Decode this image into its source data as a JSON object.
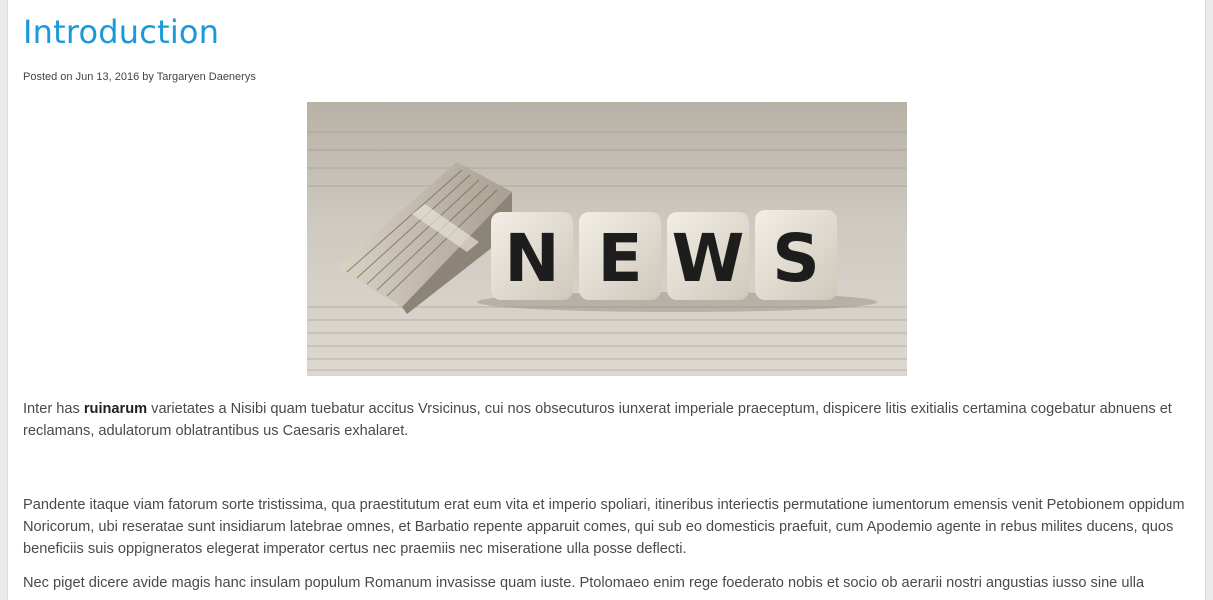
{
  "post": {
    "title": "Introduction",
    "meta": {
      "prefix": "Posted on",
      "date": "Jun 13, 2016",
      "by": "by",
      "author": "Targaryen Daenerys"
    },
    "image": {
      "dice_letters": [
        "N",
        "E",
        "W",
        "S"
      ]
    },
    "paragraphs": {
      "p1_before": "Inter has ",
      "p1_bold": "ruinarum",
      "p1_after": " varietates a Nisibi quam tuebatur accitus Vrsicinus, cui nos obsecuturos iunxerat imperiale praeceptum, dispicere litis exitialis certamina cogebatur abnuens et reclamans, adulatorum oblatrantibus us Caesaris exhalaret.",
      "p2": "Pandente itaque viam fatorum sorte tristissima, qua praestitutum erat eum vita et imperio spoliari, itineribus interiectis permutatione iumentorum emensis venit Petobionem oppidum Noricorum, ubi reseratae sunt insidiarum latebrae omnes, et Barbatio repente apparuit comes, qui sub eo domesticis praefuit, cum Apodemio agente in rebus milites ducens, quos beneficiis suis oppigneratos elegerat imperator certus nec praemiis nec miseratione ulla posse deflecti.",
      "p3": "Nec piget dicere avide magis hanc insulam populum Romanum invasisse quam iuste. Ptolomaeo enim rege foederato nobis et socio ob aerarii nostri angustias iusso sine ulla"
    }
  }
}
